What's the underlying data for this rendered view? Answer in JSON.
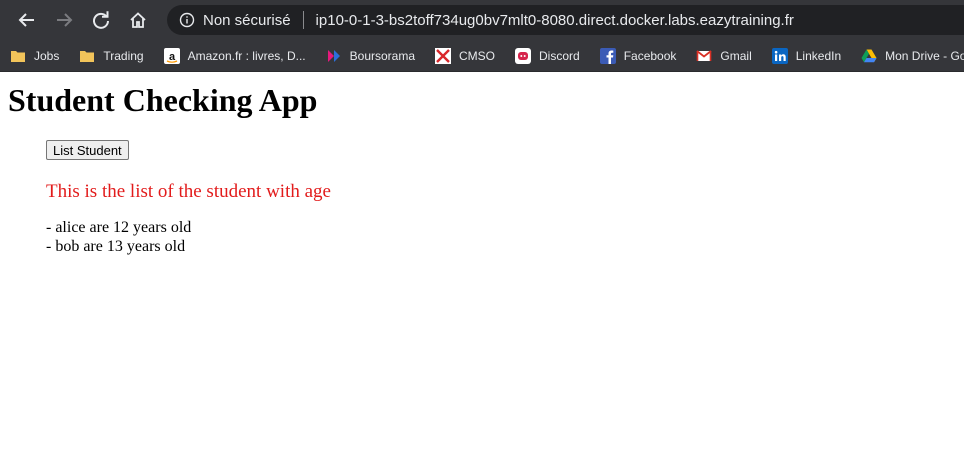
{
  "browser": {
    "security_label": "Non sécurisé",
    "url": "ip10-0-1-3-bs2toff734ug0bv7mlt0-8080.direct.docker.labs.eazytraining.fr"
  },
  "bookmarks": [
    {
      "label": "Jobs",
      "icon": "folder-icon"
    },
    {
      "label": "Trading",
      "icon": "folder-icon"
    },
    {
      "label": "Amazon.fr : livres, D...",
      "icon": "amazon-icon"
    },
    {
      "label": "Boursorama",
      "icon": "boursorama-icon"
    },
    {
      "label": "CMSO",
      "icon": "cmso-icon"
    },
    {
      "label": "Discord",
      "icon": "discord-icon"
    },
    {
      "label": "Facebook",
      "icon": "facebook-icon"
    },
    {
      "label": "Gmail",
      "icon": "gmail-icon"
    },
    {
      "label": "LinkedIn",
      "icon": "linkedin-icon"
    },
    {
      "label": "Mon Drive - Googl...",
      "icon": "drive-icon"
    }
  ],
  "page": {
    "title": "Student Checking App",
    "button_label": "List Student",
    "headline": "This is the list of the student with age",
    "students": [
      "- alice are 12 years old",
      "- bob are 13 years old"
    ]
  },
  "colors": {
    "headline": "#e21b1b",
    "chrome": "#35363a"
  }
}
